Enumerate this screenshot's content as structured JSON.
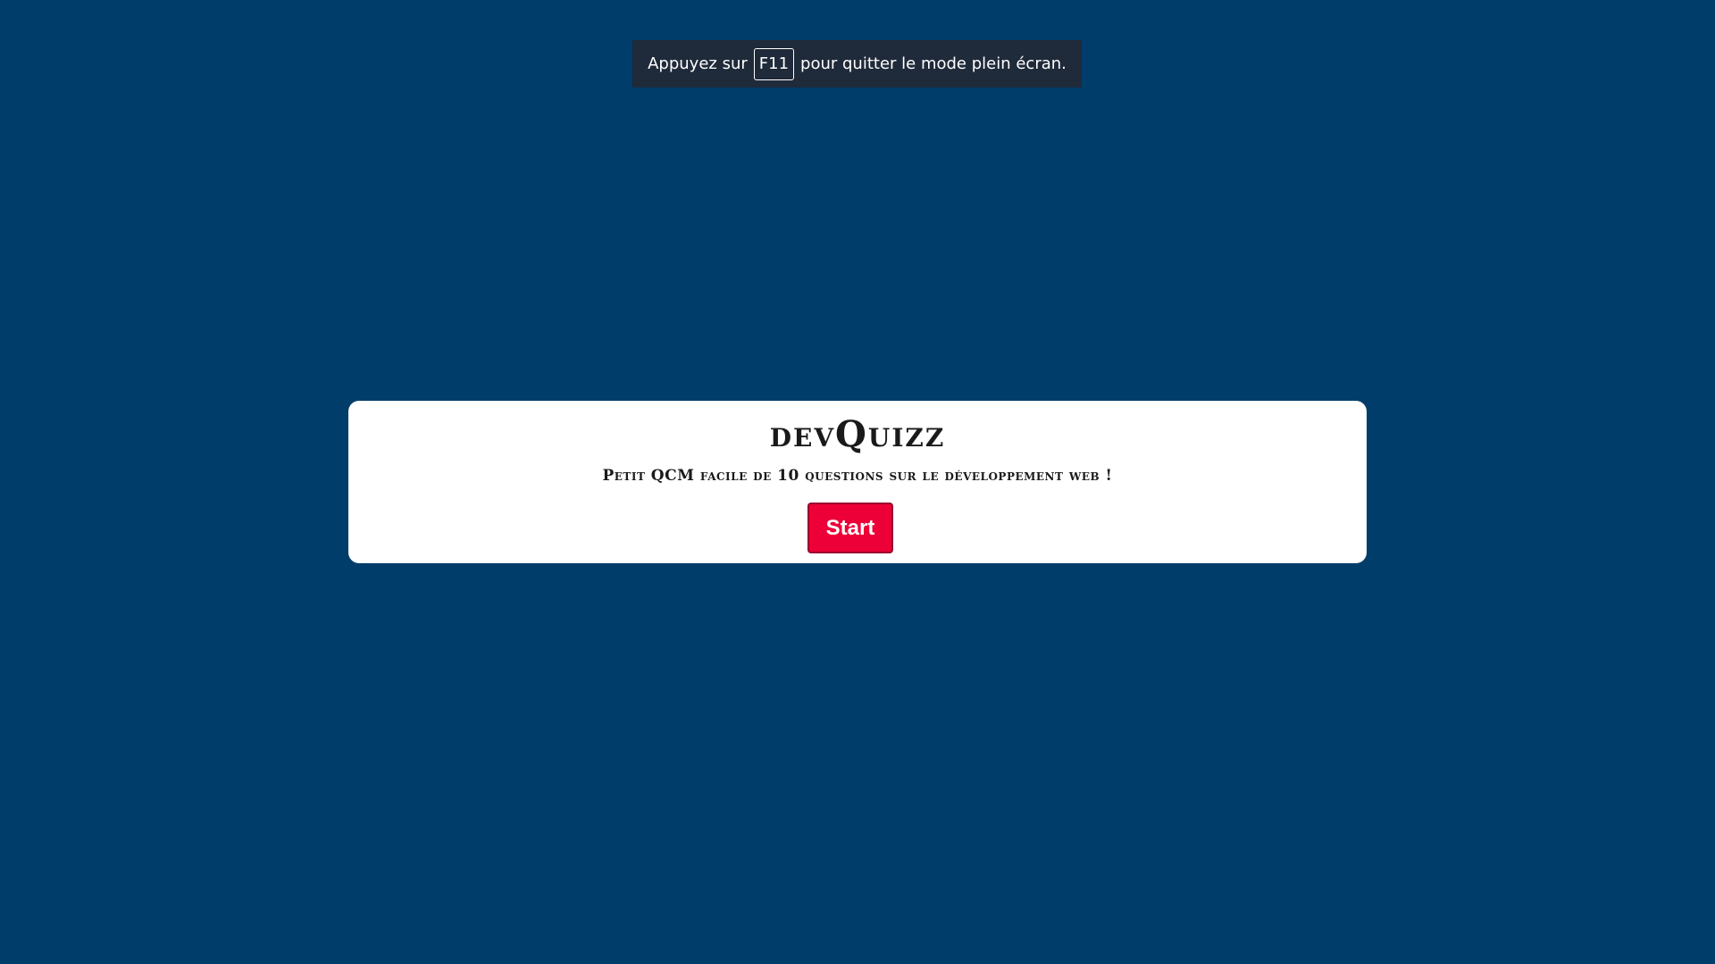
{
  "fullscreen_notice": {
    "before": "Appuyez sur",
    "key": "F11",
    "after": "pour quitter le mode plein écran."
  },
  "quiz": {
    "title": "devQuizz",
    "subtitle": "Petit QCM facile de 10 questions sur le développement web !",
    "start_label": "Start"
  },
  "colors": {
    "background": "#003d6a",
    "card": "#ffffff",
    "start_button": "#ec0037"
  }
}
